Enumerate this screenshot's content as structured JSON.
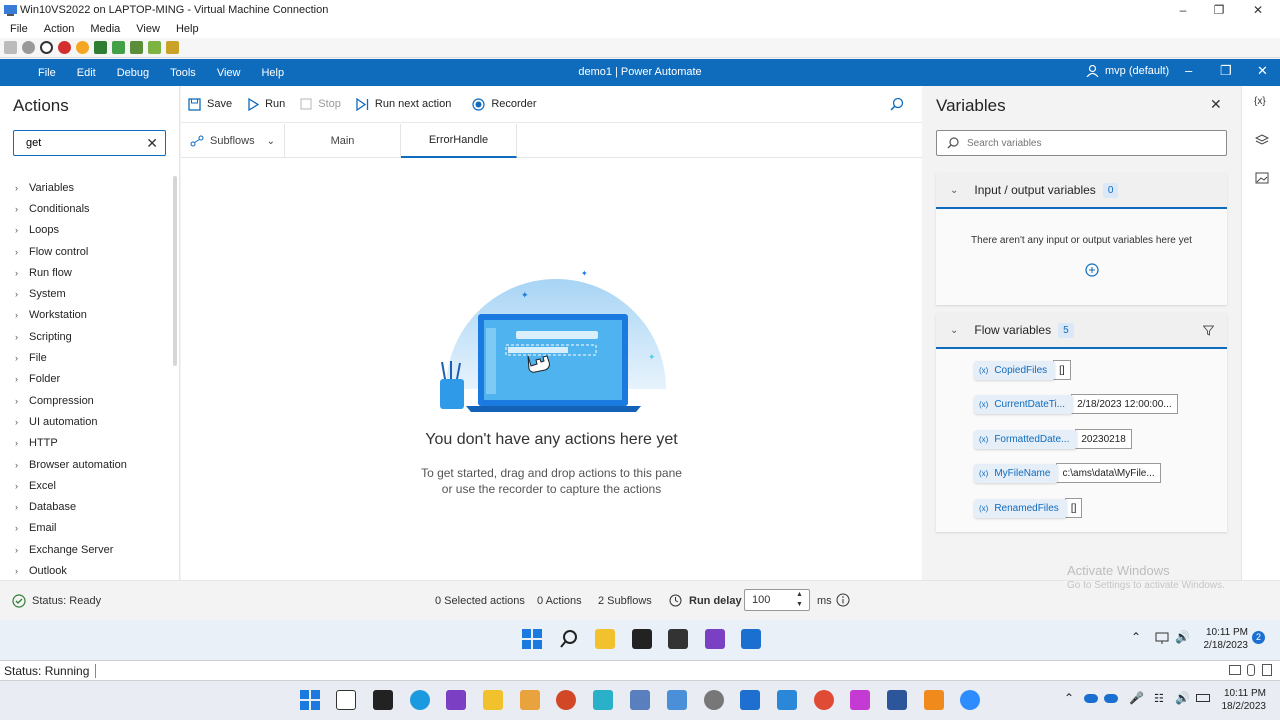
{
  "vm": {
    "title": "Win10VS2022 on LAPTOP-MING - Virtual Machine Connection",
    "menu": [
      "File",
      "Action",
      "Media",
      "View",
      "Help"
    ],
    "status": "Status: Running"
  },
  "app": {
    "menu": [
      "File",
      "Edit",
      "Debug",
      "Tools",
      "View",
      "Help"
    ],
    "title": "demo1 | Power Automate",
    "user": "mvp (default)",
    "accent": "#0f6cbd"
  },
  "actions": {
    "heading": "Actions",
    "search_value": "get",
    "items": [
      "Variables",
      "Conditionals",
      "Loops",
      "Flow control",
      "Run flow",
      "System",
      "Workstation",
      "Scripting",
      "File",
      "Folder",
      "Compression",
      "UI automation",
      "HTTP",
      "Browser automation",
      "Excel",
      "Database",
      "Email",
      "Exchange Server",
      "Outlook"
    ]
  },
  "toolbar": {
    "save": "Save",
    "run": "Run",
    "stop": "Stop",
    "run_next": "Run next action",
    "recorder": "Recorder"
  },
  "tabs": {
    "subflows": "Subflows",
    "main": "Main",
    "error": "ErrorHandle"
  },
  "empty": {
    "title": "You don't have any actions here yet",
    "line1": "To get started, drag and drop actions to this pane",
    "line2": "or use the recorder to capture the actions"
  },
  "variables": {
    "heading": "Variables",
    "search_placeholder": "Search variables",
    "io_title": "Input / output variables",
    "io_count": "0",
    "io_empty": "There aren't any input or output variables here yet",
    "flow_title": "Flow variables",
    "flow_count": "5",
    "flow": [
      {
        "name": "CopiedFiles",
        "value": "[]"
      },
      {
        "name": "CurrentDateTi...",
        "value": "2/18/2023 12:00:00..."
      },
      {
        "name": "FormattedDate...",
        "value": "20230218"
      },
      {
        "name": "MyFileName",
        "value": "c:\\ams\\data\\MyFile..."
      },
      {
        "name": "RenamedFiles",
        "value": "[]"
      }
    ]
  },
  "status": {
    "ready": "Status: Ready",
    "selected": "0 Selected actions",
    "actions": "0 Actions",
    "subflows": "2 Subflows",
    "run_delay_label": "Run delay",
    "run_delay_value": "100",
    "unit": "ms"
  },
  "watermark": {
    "line1": "Activate Windows",
    "line2": "Go to Settings to activate Windows."
  },
  "guest_clock": {
    "time": "10:11 PM",
    "date": "2/18/2023",
    "badge": "2"
  },
  "host_clock": {
    "time": "10:11 PM",
    "date": "18/2/2023"
  }
}
